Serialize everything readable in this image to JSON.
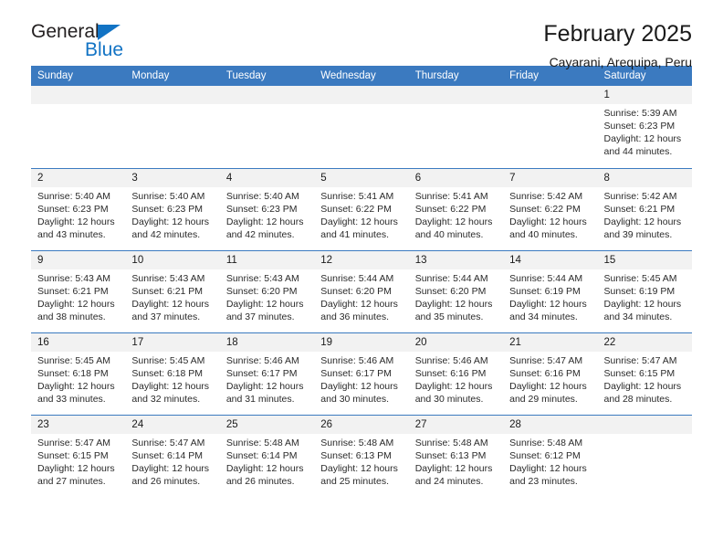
{
  "brand": {
    "name_line1": "General",
    "name_line2": "Blue",
    "primary_color": "#1273c4"
  },
  "header": {
    "title": "February 2025",
    "subtitle": "Cayarani, Arequipa, Peru",
    "header_bg_color": "#3b7ac0",
    "day_header_text_color": "#ffffff"
  },
  "calendar": {
    "weekday_headers": [
      "Sunday",
      "Monday",
      "Tuesday",
      "Wednesday",
      "Thursday",
      "Friday",
      "Saturday"
    ],
    "labels": {
      "sunrise": "Sunrise:",
      "sunset": "Sunset:",
      "daylight": "Daylight:"
    },
    "weeks": [
      [
        {
          "day": "",
          "empty": true
        },
        {
          "day": "",
          "empty": true
        },
        {
          "day": "",
          "empty": true
        },
        {
          "day": "",
          "empty": true
        },
        {
          "day": "",
          "empty": true
        },
        {
          "day": "",
          "empty": true
        },
        {
          "day": "1",
          "sunrise": "Sunrise: 5:39 AM",
          "sunset": "Sunset: 6:23 PM",
          "daylight_line1": "Daylight: 12 hours",
          "daylight_line2": "and 44 minutes."
        }
      ],
      [
        {
          "day": "2",
          "sunrise": "Sunrise: 5:40 AM",
          "sunset": "Sunset: 6:23 PM",
          "daylight_line1": "Daylight: 12 hours",
          "daylight_line2": "and 43 minutes."
        },
        {
          "day": "3",
          "sunrise": "Sunrise: 5:40 AM",
          "sunset": "Sunset: 6:23 PM",
          "daylight_line1": "Daylight: 12 hours",
          "daylight_line2": "and 42 minutes."
        },
        {
          "day": "4",
          "sunrise": "Sunrise: 5:40 AM",
          "sunset": "Sunset: 6:23 PM",
          "daylight_line1": "Daylight: 12 hours",
          "daylight_line2": "and 42 minutes."
        },
        {
          "day": "5",
          "sunrise": "Sunrise: 5:41 AM",
          "sunset": "Sunset: 6:22 PM",
          "daylight_line1": "Daylight: 12 hours",
          "daylight_line2": "and 41 minutes."
        },
        {
          "day": "6",
          "sunrise": "Sunrise: 5:41 AM",
          "sunset": "Sunset: 6:22 PM",
          "daylight_line1": "Daylight: 12 hours",
          "daylight_line2": "and 40 minutes."
        },
        {
          "day": "7",
          "sunrise": "Sunrise: 5:42 AM",
          "sunset": "Sunset: 6:22 PM",
          "daylight_line1": "Daylight: 12 hours",
          "daylight_line2": "and 40 minutes."
        },
        {
          "day": "8",
          "sunrise": "Sunrise: 5:42 AM",
          "sunset": "Sunset: 6:21 PM",
          "daylight_line1": "Daylight: 12 hours",
          "daylight_line2": "and 39 minutes."
        }
      ],
      [
        {
          "day": "9",
          "sunrise": "Sunrise: 5:43 AM",
          "sunset": "Sunset: 6:21 PM",
          "daylight_line1": "Daylight: 12 hours",
          "daylight_line2": "and 38 minutes."
        },
        {
          "day": "10",
          "sunrise": "Sunrise: 5:43 AM",
          "sunset": "Sunset: 6:21 PM",
          "daylight_line1": "Daylight: 12 hours",
          "daylight_line2": "and 37 minutes."
        },
        {
          "day": "11",
          "sunrise": "Sunrise: 5:43 AM",
          "sunset": "Sunset: 6:20 PM",
          "daylight_line1": "Daylight: 12 hours",
          "daylight_line2": "and 37 minutes."
        },
        {
          "day": "12",
          "sunrise": "Sunrise: 5:44 AM",
          "sunset": "Sunset: 6:20 PM",
          "daylight_line1": "Daylight: 12 hours",
          "daylight_line2": "and 36 minutes."
        },
        {
          "day": "13",
          "sunrise": "Sunrise: 5:44 AM",
          "sunset": "Sunset: 6:20 PM",
          "daylight_line1": "Daylight: 12 hours",
          "daylight_line2": "and 35 minutes."
        },
        {
          "day": "14",
          "sunrise": "Sunrise: 5:44 AM",
          "sunset": "Sunset: 6:19 PM",
          "daylight_line1": "Daylight: 12 hours",
          "daylight_line2": "and 34 minutes."
        },
        {
          "day": "15",
          "sunrise": "Sunrise: 5:45 AM",
          "sunset": "Sunset: 6:19 PM",
          "daylight_line1": "Daylight: 12 hours",
          "daylight_line2": "and 34 minutes."
        }
      ],
      [
        {
          "day": "16",
          "sunrise": "Sunrise: 5:45 AM",
          "sunset": "Sunset: 6:18 PM",
          "daylight_line1": "Daylight: 12 hours",
          "daylight_line2": "and 33 minutes."
        },
        {
          "day": "17",
          "sunrise": "Sunrise: 5:45 AM",
          "sunset": "Sunset: 6:18 PM",
          "daylight_line1": "Daylight: 12 hours",
          "daylight_line2": "and 32 minutes."
        },
        {
          "day": "18",
          "sunrise": "Sunrise: 5:46 AM",
          "sunset": "Sunset: 6:17 PM",
          "daylight_line1": "Daylight: 12 hours",
          "daylight_line2": "and 31 minutes."
        },
        {
          "day": "19",
          "sunrise": "Sunrise: 5:46 AM",
          "sunset": "Sunset: 6:17 PM",
          "daylight_line1": "Daylight: 12 hours",
          "daylight_line2": "and 30 minutes."
        },
        {
          "day": "20",
          "sunrise": "Sunrise: 5:46 AM",
          "sunset": "Sunset: 6:16 PM",
          "daylight_line1": "Daylight: 12 hours",
          "daylight_line2": "and 30 minutes."
        },
        {
          "day": "21",
          "sunrise": "Sunrise: 5:47 AM",
          "sunset": "Sunset: 6:16 PM",
          "daylight_line1": "Daylight: 12 hours",
          "daylight_line2": "and 29 minutes."
        },
        {
          "day": "22",
          "sunrise": "Sunrise: 5:47 AM",
          "sunset": "Sunset: 6:15 PM",
          "daylight_line1": "Daylight: 12 hours",
          "daylight_line2": "and 28 minutes."
        }
      ],
      [
        {
          "day": "23",
          "sunrise": "Sunrise: 5:47 AM",
          "sunset": "Sunset: 6:15 PM",
          "daylight_line1": "Daylight: 12 hours",
          "daylight_line2": "and 27 minutes."
        },
        {
          "day": "24",
          "sunrise": "Sunrise: 5:47 AM",
          "sunset": "Sunset: 6:14 PM",
          "daylight_line1": "Daylight: 12 hours",
          "daylight_line2": "and 26 minutes."
        },
        {
          "day": "25",
          "sunrise": "Sunrise: 5:48 AM",
          "sunset": "Sunset: 6:14 PM",
          "daylight_line1": "Daylight: 12 hours",
          "daylight_line2": "and 26 minutes."
        },
        {
          "day": "26",
          "sunrise": "Sunrise: 5:48 AM",
          "sunset": "Sunset: 6:13 PM",
          "daylight_line1": "Daylight: 12 hours",
          "daylight_line2": "and 25 minutes."
        },
        {
          "day": "27",
          "sunrise": "Sunrise: 5:48 AM",
          "sunset": "Sunset: 6:13 PM",
          "daylight_line1": "Daylight: 12 hours",
          "daylight_line2": "and 24 minutes."
        },
        {
          "day": "28",
          "sunrise": "Sunrise: 5:48 AM",
          "sunset": "Sunset: 6:12 PM",
          "daylight_line1": "Daylight: 12 hours",
          "daylight_line2": "and 23 minutes."
        },
        {
          "day": "",
          "empty": true
        }
      ]
    ]
  }
}
